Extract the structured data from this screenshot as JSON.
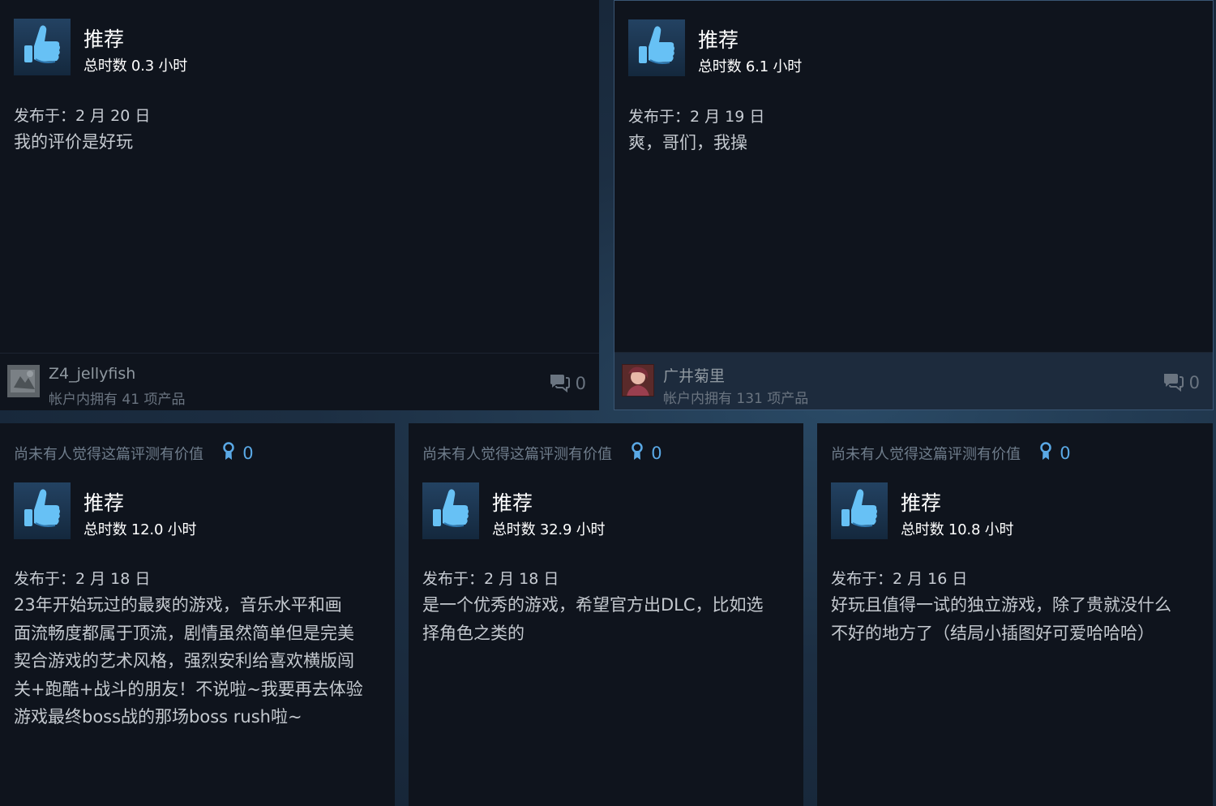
{
  "reviews_top": [
    {
      "recommendation": "推荐",
      "hours": "总时数 0.3 小时",
      "posted": "发布于：2 月 20 日",
      "content": "我的评价是好玩",
      "author": "Z4_jellyfish",
      "products": "帐户内拥有 41 项产品",
      "comments": "0"
    },
    {
      "recommendation": "推荐",
      "hours": "总时数 6.1 小时",
      "posted": "发布于：2 月 19 日",
      "content": "爽，哥们，我操",
      "author": "广井菊里",
      "products": "帐户内拥有 131 项产品",
      "comments": "0"
    }
  ],
  "reviews_bottom": [
    {
      "helpful_text": "尚未有人觉得这篇评测有价值",
      "awards": "0",
      "recommendation": "推荐",
      "hours": "总时数 12.0 小时",
      "posted": "发布于：2 月 18 日",
      "content_lines": [
        "23年开始玩过的最爽的游戏，音乐水平和画",
        "面流畅度都属于顶流，剧情虽然简单但是完美",
        "契合游戏的艺术风格，强烈安利给喜欢横版闯",
        "关+跑酷+战斗的朋友！不说啦~我要再去体验",
        "游戏最终boss战的那场boss rush啦~"
      ]
    },
    {
      "helpful_text": "尚未有人觉得这篇评测有价值",
      "awards": "0",
      "recommendation": "推荐",
      "hours": "总时数 32.9 小时",
      "posted": "发布于：2 月 18 日",
      "content_lines": [
        "是一个优秀的游戏，希望官方出DLC，比如选",
        "择角色之类的"
      ]
    },
    {
      "helpful_text": "尚未有人觉得这篇评测有价值",
      "awards": "0",
      "recommendation": "推荐",
      "hours": "总时数 10.8 小时",
      "posted": "发布于：2 月 16 日",
      "content_lines": [
        "好玩且值得一试的独立游戏，除了贵就没什么",
        "不好的地方了（结局小插图好可爱哈哈哈）"
      ]
    }
  ],
  "colors": {
    "card_bg": "#0f141d",
    "page_bg": "#1f3145",
    "accent_blue": "#5aa9e6",
    "thumb_blue": "#67c1f5"
  },
  "icons": {
    "thumb": "thumbs-up-icon",
    "award": "award-icon",
    "comment": "comment-bubble-icon"
  }
}
